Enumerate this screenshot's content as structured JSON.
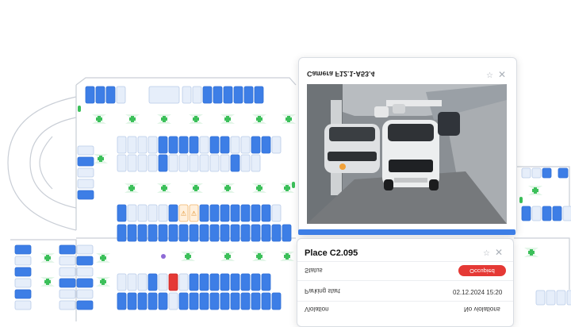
{
  "camera_panel": {
    "title": "Camera F12.1-A53.4",
    "pin_icon": "pin-icon",
    "close_icon": "close-icon"
  },
  "place_panel": {
    "title": "Place C2.095",
    "pin_icon": "pin-icon",
    "close_icon": "close-icon",
    "status_label": "Status",
    "status_value": "Occupied",
    "parking_start_label": "Parking start",
    "parking_start_value": "02.12.2024 15:20",
    "violation_label": "Violation",
    "violation_value": "No violations"
  },
  "colors": {
    "occupied_space": "#3d7ee6",
    "free_space": "#e6eefa",
    "selected_space": "#e53935",
    "warning_space": "#fff0dd",
    "camera_marker": "#3cc05a",
    "status_badge": "#e53935"
  },
  "icons": {
    "warning": "warning-icon",
    "camera": "camera-marker-icon"
  }
}
